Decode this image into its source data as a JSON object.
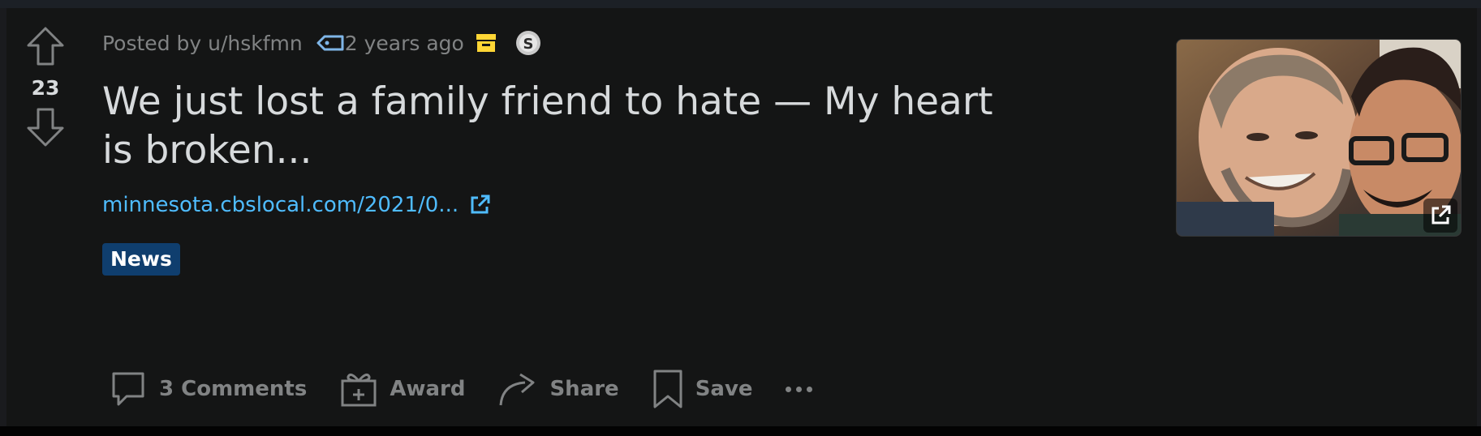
{
  "post": {
    "score": "23",
    "posted_by": "Posted by u/hskfmn",
    "time_ago": "2 years ago",
    "title": "We just lost a family friend to hate — My heart is broken...",
    "link_text": "minnesota.cbslocal.com/2021/0...",
    "flair": "News"
  },
  "actions": {
    "comments_label": "3 Comments",
    "award_label": "Award",
    "share_label": "Share",
    "save_label": "Save"
  },
  "icons": {
    "upvote": "arrow-up-outline-icon",
    "downvote": "arrow-down-outline-icon",
    "tag": "tag-icon",
    "archive": "archive-box-icon",
    "award": "award-coin-icon",
    "external": "external-link-icon",
    "comments": "speech-bubble-icon",
    "gift": "gift-icon",
    "share": "share-arrow-icon",
    "save": "bookmark-icon",
    "more": "ellipsis-icon"
  },
  "colors": {
    "card_bg": "#141515",
    "link": "#4fbcff",
    "flair_bg": "#0f3e6e",
    "archive": "#ffd635",
    "muted": "#818384",
    "text": "#d7dadc"
  }
}
